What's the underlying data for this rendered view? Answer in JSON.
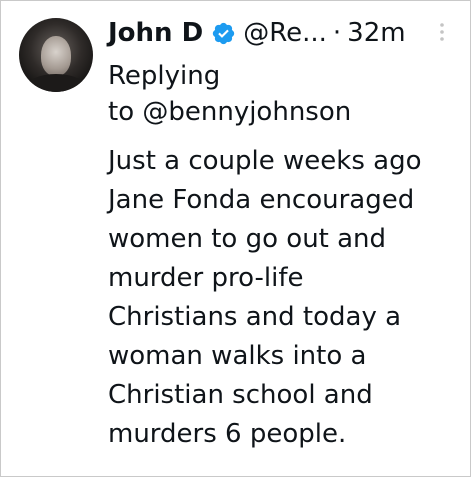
{
  "tweet": {
    "author_name": "John D",
    "handle": "@Re...",
    "separator": "·",
    "timestamp": "32m",
    "reply_prefix": "Replying",
    "reply_to": "to @bennyjohnson",
    "text_lines": [
      "Just a couple weeks ago",
      "Jane Fonda encouraged",
      "women to go out and",
      "murder pro-life",
      "Christians and today a",
      "woman walks into a",
      "Christian school and",
      "murders 6 people."
    ]
  },
  "icons": {
    "verified": "verified-badge-icon",
    "more": "more-options-icon"
  },
  "colors": {
    "text": "#0f1419",
    "verified_blue": "#1d9bf0",
    "more_icon": "#c4c4c4",
    "border": "#c9c9c9"
  }
}
